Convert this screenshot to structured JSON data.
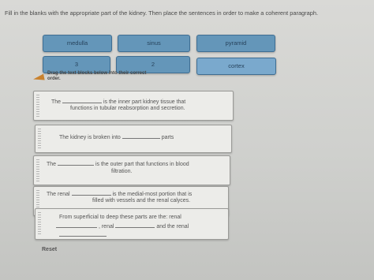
{
  "instructions": "Fill in the blanks with the appropriate part of the kidney. Then place the sentences in order to make a coherent paragraph.",
  "word_bank": [
    "medulla",
    "sinus",
    "pyramid",
    "3",
    "2",
    "cortex"
  ],
  "hint": "Drag the text blocks below into their correct order.",
  "sentences": [
    {
      "pre": "The",
      "post_line1": "is the inner part kidney tissue that",
      "line2": "functions in tubular reabsorption and secretion."
    },
    {
      "pre": "The kidney is broken into",
      "post_line1": "parts"
    },
    {
      "pre": "The",
      "post_line1": "is the outer part that functions in blood",
      "line2": "filtration."
    },
    {
      "pre": "The renal",
      "post_line1": "is the medial-most portion that is",
      "line2": "filled with vessels and the renal calyces."
    },
    {
      "pre": "From superficial to deep these parts are the: renal",
      "line2_pre": ", renal",
      "line2_mid": "and the renal"
    }
  ],
  "reset_label": "Reset"
}
